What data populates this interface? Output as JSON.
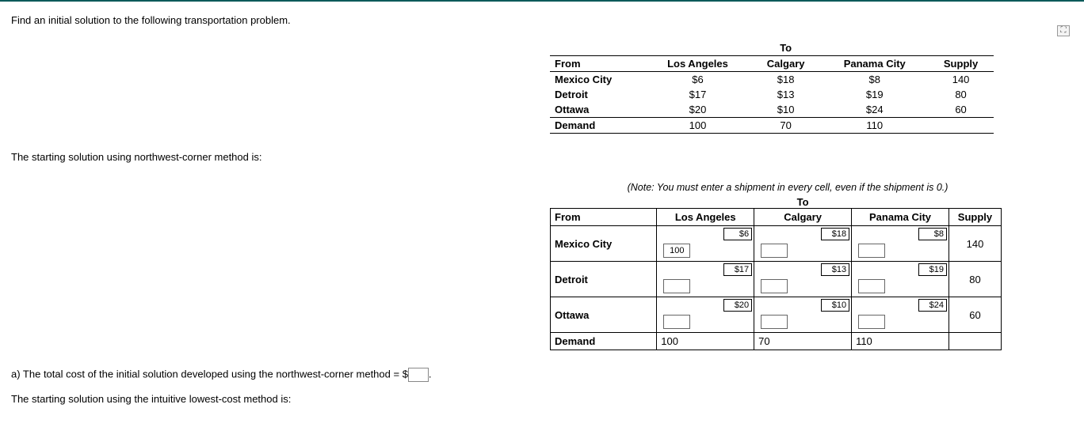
{
  "prompt": "Find an initial solution to the following transportation problem.",
  "sub1": "The starting solution using northwest-corner method is:",
  "note": "(Note: You must enter a shipment in every cell, even if the shipment is 0.)",
  "answer_a_prefix": "a) The total cost of the initial solution developed using the northwest-corner method = $",
  "answer_a_suffix": ".",
  "sub2": "The starting solution using the intuitive lowest-cost method is:",
  "to_label": "To",
  "headers": {
    "from": "From",
    "la": "Los Angeles",
    "calgary": "Calgary",
    "panama": "Panama City",
    "supply": "Supply"
  },
  "rows": {
    "mexico": "Mexico City",
    "detroit": "Detroit",
    "ottawa": "Ottawa",
    "demand": "Demand"
  },
  "costs": {
    "mexico": {
      "la": "$6",
      "calgary": "$18",
      "panama": "$8"
    },
    "detroit": {
      "la": "$17",
      "calgary": "$13",
      "panama": "$19"
    },
    "ottawa": {
      "la": "$20",
      "calgary": "$10",
      "panama": "$24"
    }
  },
  "supply": {
    "mexico": "140",
    "detroit": "80",
    "ottawa": "60"
  },
  "demand": {
    "la": "100",
    "calgary": "70",
    "panama": "110"
  },
  "ship": {
    "mexico_la": "100"
  }
}
